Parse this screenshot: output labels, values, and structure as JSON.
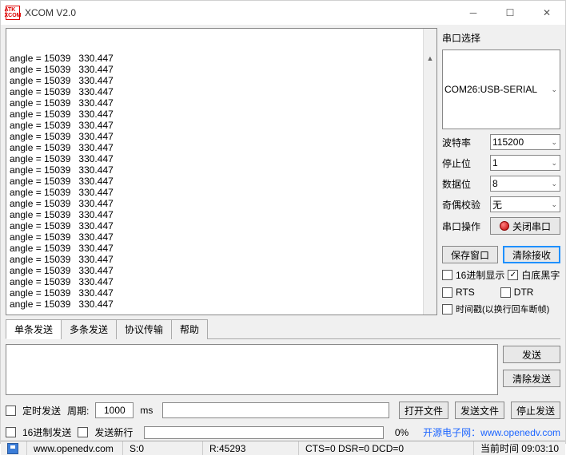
{
  "window": {
    "title": "XCOM V2.0",
    "logo_text": "ATK\nXCOM"
  },
  "terminal": {
    "lines": [
      "angle = 15039   330.447",
      "angle = 15039   330.447",
      "angle = 15039   330.447",
      "angle = 15039   330.447",
      "angle = 15039   330.447",
      "angle = 15039   330.447",
      "angle = 15039   330.447",
      "angle = 15039   330.447",
      "angle = 15039   330.447",
      "angle = 15039   330.447",
      "angle = 15039   330.447",
      "angle = 15039   330.447",
      "angle = 15039   330.447",
      "angle = 15039   330.447",
      "angle = 15039   330.447",
      "angle = 15039   330.447",
      "angle = 15039   330.447",
      "angle = 15039   330.447",
      "angle = 15039   330.447",
      "angle = 15039   330.447",
      "angle = 15039   330.447",
      "angle = 15039   330.447",
      "angle = 15039   330.447"
    ]
  },
  "side": {
    "port_select_label": "串口选择",
    "port_value": "COM26:USB-SERIAL",
    "baud_label": "波特率",
    "baud_value": "115200",
    "stop_label": "停止位",
    "stop_value": "1",
    "data_label": "数据位",
    "data_value": "8",
    "parity_label": "奇偶校验",
    "parity_value": "无",
    "op_label": "串口操作",
    "close_port": "关闭串口",
    "save_window": "保存窗口",
    "clear_recv": "清除接收",
    "hex_display": "16进制显示",
    "white_bg": "白底黑字",
    "rts": "RTS",
    "dtr": "DTR",
    "timestamp": "时间戳(以换行回车断帧)"
  },
  "tabs": {
    "single": "单条发送",
    "multi": "多条发送",
    "protocol": "协议传输",
    "help": "帮助"
  },
  "send": {
    "send_btn": "发送",
    "clear_send": "清除发送",
    "timed_send": "定时发送",
    "period_label": "周期:",
    "period_value": "1000",
    "period_unit": "ms",
    "open_file": "打开文件",
    "send_file": "发送文件",
    "stop_send": "停止发送",
    "hex_send": "16进制发送",
    "send_newline": "发送新行",
    "progress_pct": "0%",
    "promo_label": "开源电子网：",
    "promo_url": "www.openedv.com"
  },
  "status": {
    "url": "www.openedv.com",
    "s": "S:0",
    "r": "R:45293",
    "signals": "CTS=0 DSR=0 DCD=0",
    "time_label": "当前时间 09:03:10"
  }
}
